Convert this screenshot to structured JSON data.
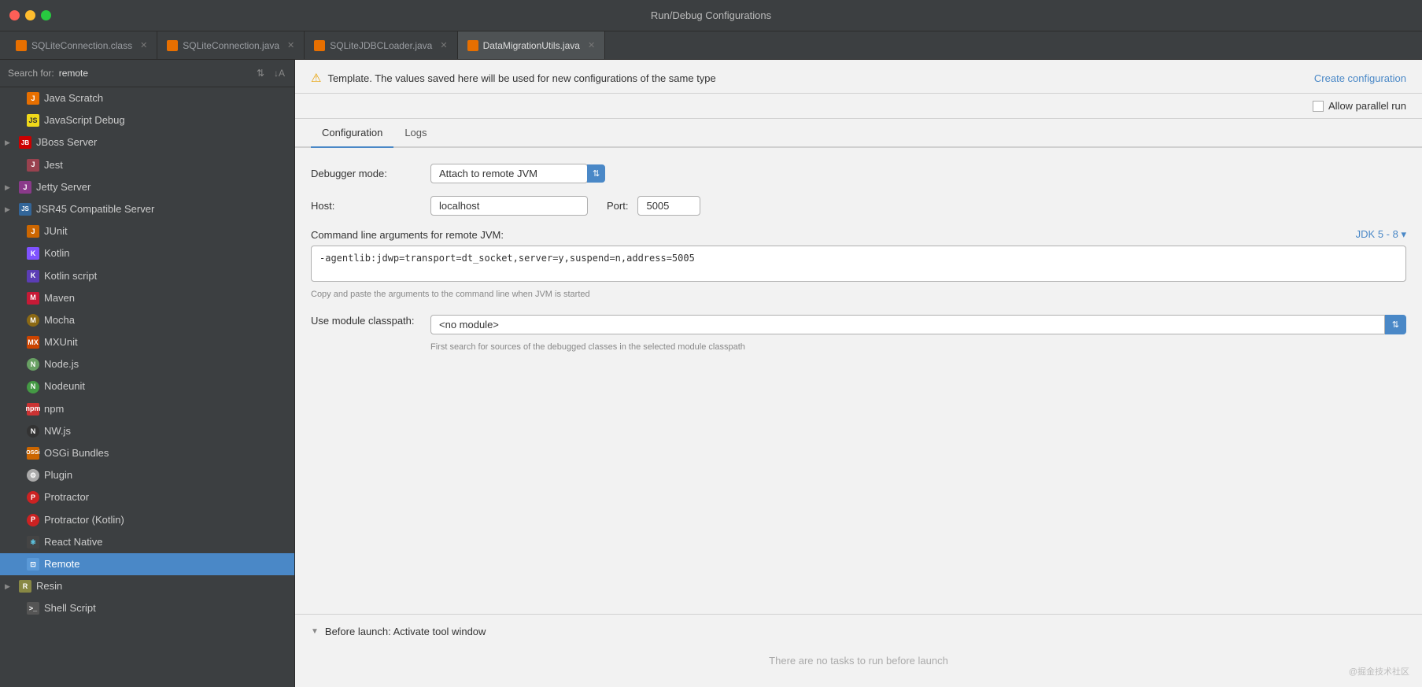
{
  "titlebar": {
    "title": "Run/Debug Configurations"
  },
  "tabs": [
    {
      "label": "SQLiteConnection.class",
      "icon": "class",
      "active": false
    },
    {
      "label": "SQLiteConnection.java",
      "icon": "java",
      "active": false
    },
    {
      "label": "SQLiteJDBCLoader.java",
      "icon": "java",
      "active": false
    },
    {
      "label": "DataMigrationUtils.java",
      "icon": "java",
      "active": true
    }
  ],
  "sidebar": {
    "search_label": "Search for:",
    "search_value": "remote",
    "items": [
      {
        "label": "Java Scratch",
        "icon": "java",
        "indent": 1,
        "arrow": false
      },
      {
        "label": "JavaScript Debug",
        "icon": "js",
        "indent": 1,
        "arrow": false
      },
      {
        "label": "JBoss Server",
        "icon": "jboss",
        "indent": 1,
        "arrow": true
      },
      {
        "label": "Jest",
        "icon": "jest",
        "indent": 1,
        "arrow": false
      },
      {
        "label": "Jetty Server",
        "icon": "jetty",
        "indent": 1,
        "arrow": true
      },
      {
        "label": "JSR45 Compatible Server",
        "icon": "jsr",
        "indent": 1,
        "arrow": true
      },
      {
        "label": "JUnit",
        "icon": "junit",
        "indent": 1,
        "arrow": false
      },
      {
        "label": "Kotlin",
        "icon": "kotlin",
        "indent": 1,
        "arrow": false
      },
      {
        "label": "Kotlin script",
        "icon": "kotlinscript",
        "indent": 1,
        "arrow": false
      },
      {
        "label": "Maven",
        "icon": "maven",
        "indent": 1,
        "arrow": false
      },
      {
        "label": "Mocha",
        "icon": "mocha",
        "indent": 1,
        "arrow": false
      },
      {
        "label": "MXUnit",
        "icon": "mxunit",
        "indent": 1,
        "arrow": false
      },
      {
        "label": "Node.js",
        "icon": "nodejs",
        "indent": 1,
        "arrow": false
      },
      {
        "label": "Nodeunit",
        "icon": "nodeunit",
        "indent": 1,
        "arrow": false
      },
      {
        "label": "npm",
        "icon": "npm",
        "indent": 1,
        "arrow": false
      },
      {
        "label": "NW.js",
        "icon": "nwjs",
        "indent": 1,
        "arrow": false
      },
      {
        "label": "OSGi Bundles",
        "icon": "osgi",
        "indent": 1,
        "arrow": false
      },
      {
        "label": "Plugin",
        "icon": "plugin",
        "indent": 1,
        "arrow": false
      },
      {
        "label": "Protractor",
        "icon": "protractor",
        "indent": 1,
        "arrow": false
      },
      {
        "label": "Protractor (Kotlin)",
        "icon": "protractor",
        "indent": 1,
        "arrow": false
      },
      {
        "label": "React Native",
        "icon": "react",
        "indent": 1,
        "arrow": false
      },
      {
        "label": "Remote",
        "icon": "remote",
        "indent": 1,
        "arrow": false,
        "selected": true
      },
      {
        "label": "Resin",
        "icon": "resin",
        "indent": 1,
        "arrow": true
      },
      {
        "label": "Shell Script",
        "icon": "shell",
        "indent": 1,
        "arrow": false
      }
    ]
  },
  "dialog": {
    "warning": "Template. The values saved here will be used for new configurations of the same type",
    "create_config": "Create configuration",
    "allow_parallel": "Allow parallel run",
    "tabs": [
      {
        "label": "Configuration",
        "active": true
      },
      {
        "label": "Logs",
        "active": false
      }
    ],
    "form": {
      "debugger_mode_label": "Debugger mode:",
      "debugger_mode_value": "Attach to remote JVM",
      "host_label": "Host:",
      "host_value": "localhost",
      "port_label": "Port:",
      "port_value": "5005",
      "command_label": "Command line arguments for remote JVM:",
      "command_value": "-agentlib:jdwp=transport=dt_socket,server=y,suspend=n,address=5005",
      "command_hint": "Copy and paste the arguments to the command line when JVM is started",
      "jdk_link": "JDK 5 - 8 ▾",
      "module_label": "Use module classpath:",
      "module_value": "<no module>",
      "module_hint": "First search for sources of the debugged classes in the selected\nmodule classpath"
    },
    "before_launch": {
      "header": "Before launch: Activate tool window",
      "empty": "There are no tasks to run before launch"
    }
  },
  "watermark": "@掘金技术社区"
}
